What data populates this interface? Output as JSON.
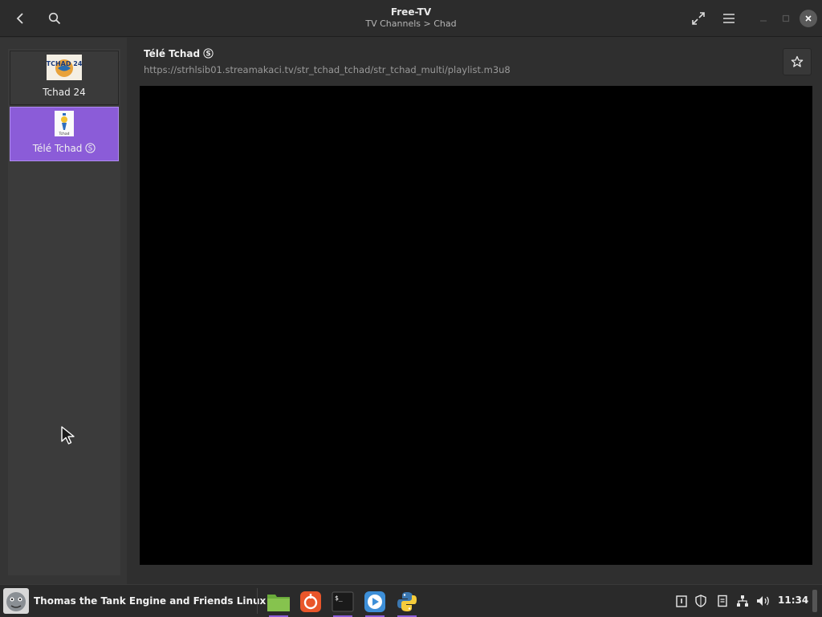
{
  "header": {
    "title": "Free-TV",
    "subtitle": "TV Channels > Chad"
  },
  "icons": {
    "back": "back-icon",
    "search": "search-icon",
    "fullscreen": "fullscreen-icon",
    "menu": "hamburger-menu-icon",
    "minimize": "minimize-icon",
    "maximize": "maximize-icon",
    "close": "close-icon",
    "star": "star-icon"
  },
  "channels": [
    {
      "label": "Tchad 24",
      "logo_text": "TCHAD 24",
      "selected": false
    },
    {
      "label": "Télé Tchad",
      "logo_text": "Tchad",
      "selected": true,
      "badge": "S"
    }
  ],
  "content": {
    "title": "Télé Tchad",
    "badge": "S",
    "url": "https://strhlsib01.streamakaci.tv/str_tchad_tchad/str_tchad_multi/playlist.m3u8"
  },
  "taskbar": {
    "menu_label": "Thomas the Tank Engine and Friends Linux",
    "apps": [
      "files-app",
      "app-center",
      "terminal-app",
      "media-player-app",
      "python-app"
    ],
    "clock": "11:34"
  },
  "colors": {
    "accent": "#8b5cd8",
    "window_bg": "#2f2f2f",
    "video_bg": "#000000"
  }
}
